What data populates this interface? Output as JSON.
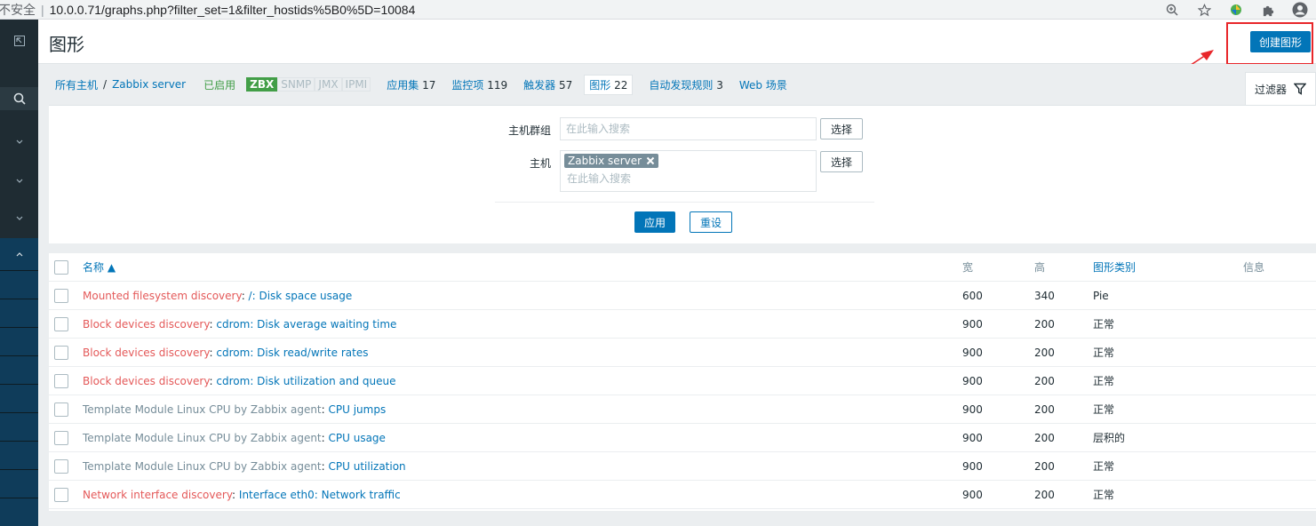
{
  "browser": {
    "insecure_label": "不安全",
    "separator": "|",
    "url": "10.0.0.71/graphs.php?filter_set=1&filter_hostids%5B0%5D=10084"
  },
  "header": {
    "title": "图形",
    "create_button": "创建图形"
  },
  "nav": {
    "all_hosts": "所有主机",
    "separator": "/",
    "host": "Zabbix server",
    "status": "已启用",
    "tags": [
      "ZBX",
      "SNMP",
      "JMX",
      "IPMI"
    ],
    "links": [
      {
        "label": "应用集",
        "count": "17"
      },
      {
        "label": "监控项",
        "count": "119"
      },
      {
        "label": "触发器",
        "count": "57"
      },
      {
        "label": "图形",
        "count": "22"
      },
      {
        "label": "自动发现规则",
        "count": "3"
      },
      {
        "label": "Web 场景",
        "count": ""
      }
    ],
    "filter_label": "过滤器"
  },
  "filter": {
    "hostgroup_label": "主机群组",
    "hostgroup_placeholder": "在此输入搜索",
    "host_label": "主机",
    "host_tag": "Zabbix server",
    "host_placeholder": "在此输入搜索",
    "select_label": "选择",
    "apply_label": "应用",
    "reset_label": "重设"
  },
  "table": {
    "headers": {
      "name": "名称 ▲",
      "width": "宽",
      "height": "高",
      "type": "图形类别",
      "info": "信息"
    },
    "rows": [
      {
        "prefix": "Mounted filesystem discovery",
        "prefix_style": "red",
        "name": "/: Disk space usage",
        "width": "600",
        "height": "340",
        "type": "Pie"
      },
      {
        "prefix": "Block devices discovery",
        "prefix_style": "red",
        "name": "cdrom: Disk average waiting time",
        "width": "900",
        "height": "200",
        "type": "正常"
      },
      {
        "prefix": "Block devices discovery",
        "prefix_style": "red",
        "name": "cdrom: Disk read/write rates",
        "width": "900",
        "height": "200",
        "type": "正常"
      },
      {
        "prefix": "Block devices discovery",
        "prefix_style": "red",
        "name": "cdrom: Disk utilization and queue",
        "width": "900",
        "height": "200",
        "type": "正常"
      },
      {
        "prefix": "Template Module Linux CPU by Zabbix agent",
        "prefix_style": "gray",
        "name": "CPU jumps",
        "width": "900",
        "height": "200",
        "type": "正常"
      },
      {
        "prefix": "Template Module Linux CPU by Zabbix agent",
        "prefix_style": "gray",
        "name": "CPU usage",
        "width": "900",
        "height": "200",
        "type": "层积的"
      },
      {
        "prefix": "Template Module Linux CPU by Zabbix agent",
        "prefix_style": "gray",
        "name": "CPU utilization",
        "width": "900",
        "height": "200",
        "type": "正常"
      },
      {
        "prefix": "Network interface discovery",
        "prefix_style": "red",
        "name": "Interface eth0: Network traffic",
        "width": "900",
        "height": "200",
        "type": "正常"
      }
    ]
  },
  "colors": {
    "accent": "#0275b8",
    "sidebar": "#1f2c33",
    "highlight": "#e8262a",
    "enabled_green": "#429e47",
    "discovery_red": "#e45959"
  }
}
